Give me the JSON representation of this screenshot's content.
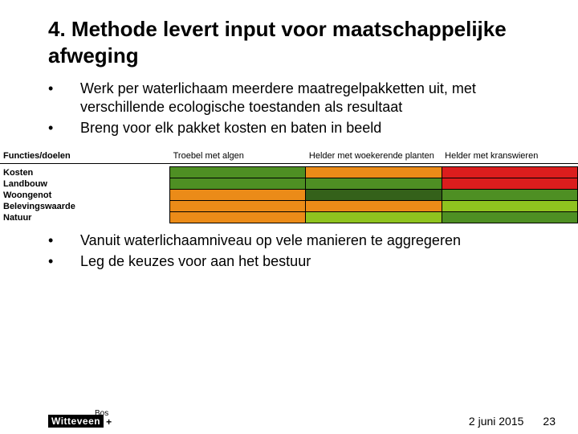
{
  "title": "4. Methode levert input voor maatschappelijke afweging",
  "bullets_top": [
    "Werk per waterlichaam meerdere maatregelpakketten uit, met verschillende ecologische toestanden als resultaat",
    "Breng voor elk pakket kosten en baten in beeld"
  ],
  "bullets_bottom": [
    "Vanuit waterlichaamniveau op vele manieren te aggregeren",
    "Leg de keuzes voor aan het bestuur"
  ],
  "matrix": {
    "head_label": "Functies/doelen",
    "columns": [
      "Troebel met algen",
      "Helder met woekerende planten",
      "Helder met kranswieren"
    ],
    "rows": [
      {
        "label": "Kosten",
        "colors": [
          "#4e8f23",
          "#eb8b18",
          "#db1d1d"
        ]
      },
      {
        "label": "Landbouw",
        "colors": [
          "#4e8f23",
          "#4e8f23",
          "#db1d1d"
        ]
      },
      {
        "label": "Woongenot",
        "colors": [
          "#eb8b18",
          "#34611a",
          "#4e8f23"
        ]
      },
      {
        "label": "Belevingswaarde",
        "colors": [
          "#eb8b18",
          "#eb8b18",
          "#8fc31f"
        ]
      },
      {
        "label": "Natuur",
        "colors": [
          "#eb8b18",
          "#8fc31f",
          "#4e8f23"
        ]
      }
    ]
  },
  "logo": {
    "top": "Bos",
    "bottom": "Witteveen",
    "plus": "+"
  },
  "footer": {
    "date": "2 juni 2015",
    "page": "23"
  },
  "colors": {
    "dark_green": "#34611a",
    "green": "#4e8f23",
    "light_green": "#8fc31f",
    "orange": "#eb8b18",
    "red": "#db1d1d"
  }
}
